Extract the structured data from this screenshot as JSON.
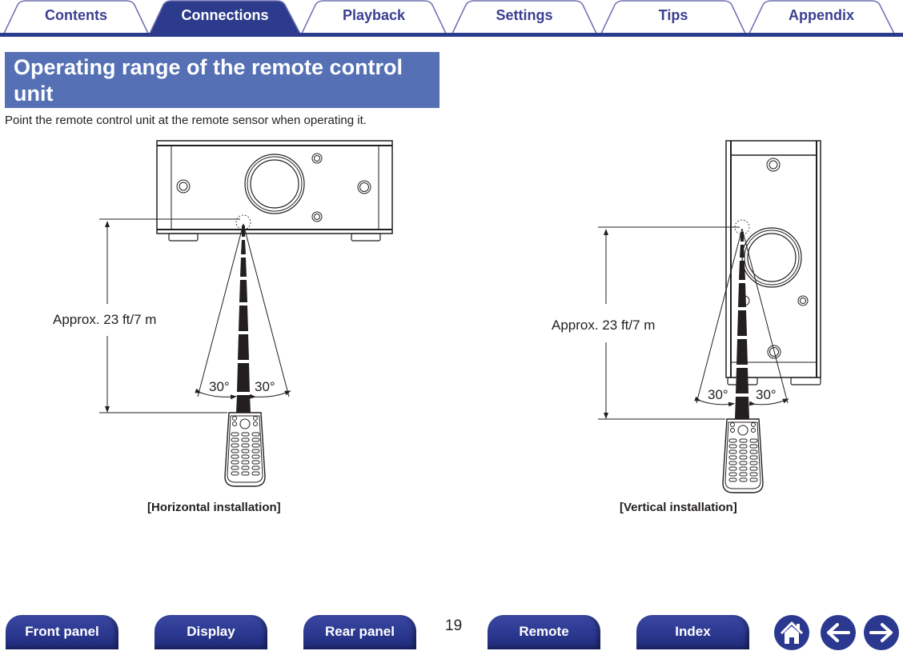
{
  "tabs": [
    {
      "label": "Contents",
      "active": false
    },
    {
      "label": "Connections",
      "active": true
    },
    {
      "label": "Playback",
      "active": false
    },
    {
      "label": "Settings",
      "active": false
    },
    {
      "label": "Tips",
      "active": false
    },
    {
      "label": "Appendix",
      "active": false
    }
  ],
  "colors": {
    "tab_active": "#2c3b8c",
    "tab_border": "#6e6fb2",
    "tab_text": "#3a3f91",
    "heading_bg": "#5570b4",
    "nav_button": "#2b3890"
  },
  "section": {
    "title": "Operating range of the remote control unit",
    "intro": "Point the remote control unit at the remote sensor when operating it."
  },
  "diagrams": {
    "horizontal": {
      "distance_label": "Approx. 23 ft/7 m",
      "angle_left": "30°",
      "angle_right": "30°",
      "caption": "[Horizontal installation]"
    },
    "vertical": {
      "distance_label": "Approx. 23 ft/7 m",
      "angle_left": "30°",
      "angle_right": "30°",
      "caption": "[Vertical installation]"
    }
  },
  "footer": {
    "page_number": "19",
    "buttons": [
      "Front panel",
      "Display",
      "Rear panel",
      "Remote",
      "Index"
    ],
    "icons": [
      "home-icon",
      "back-arrow-icon",
      "forward-arrow-icon"
    ]
  }
}
